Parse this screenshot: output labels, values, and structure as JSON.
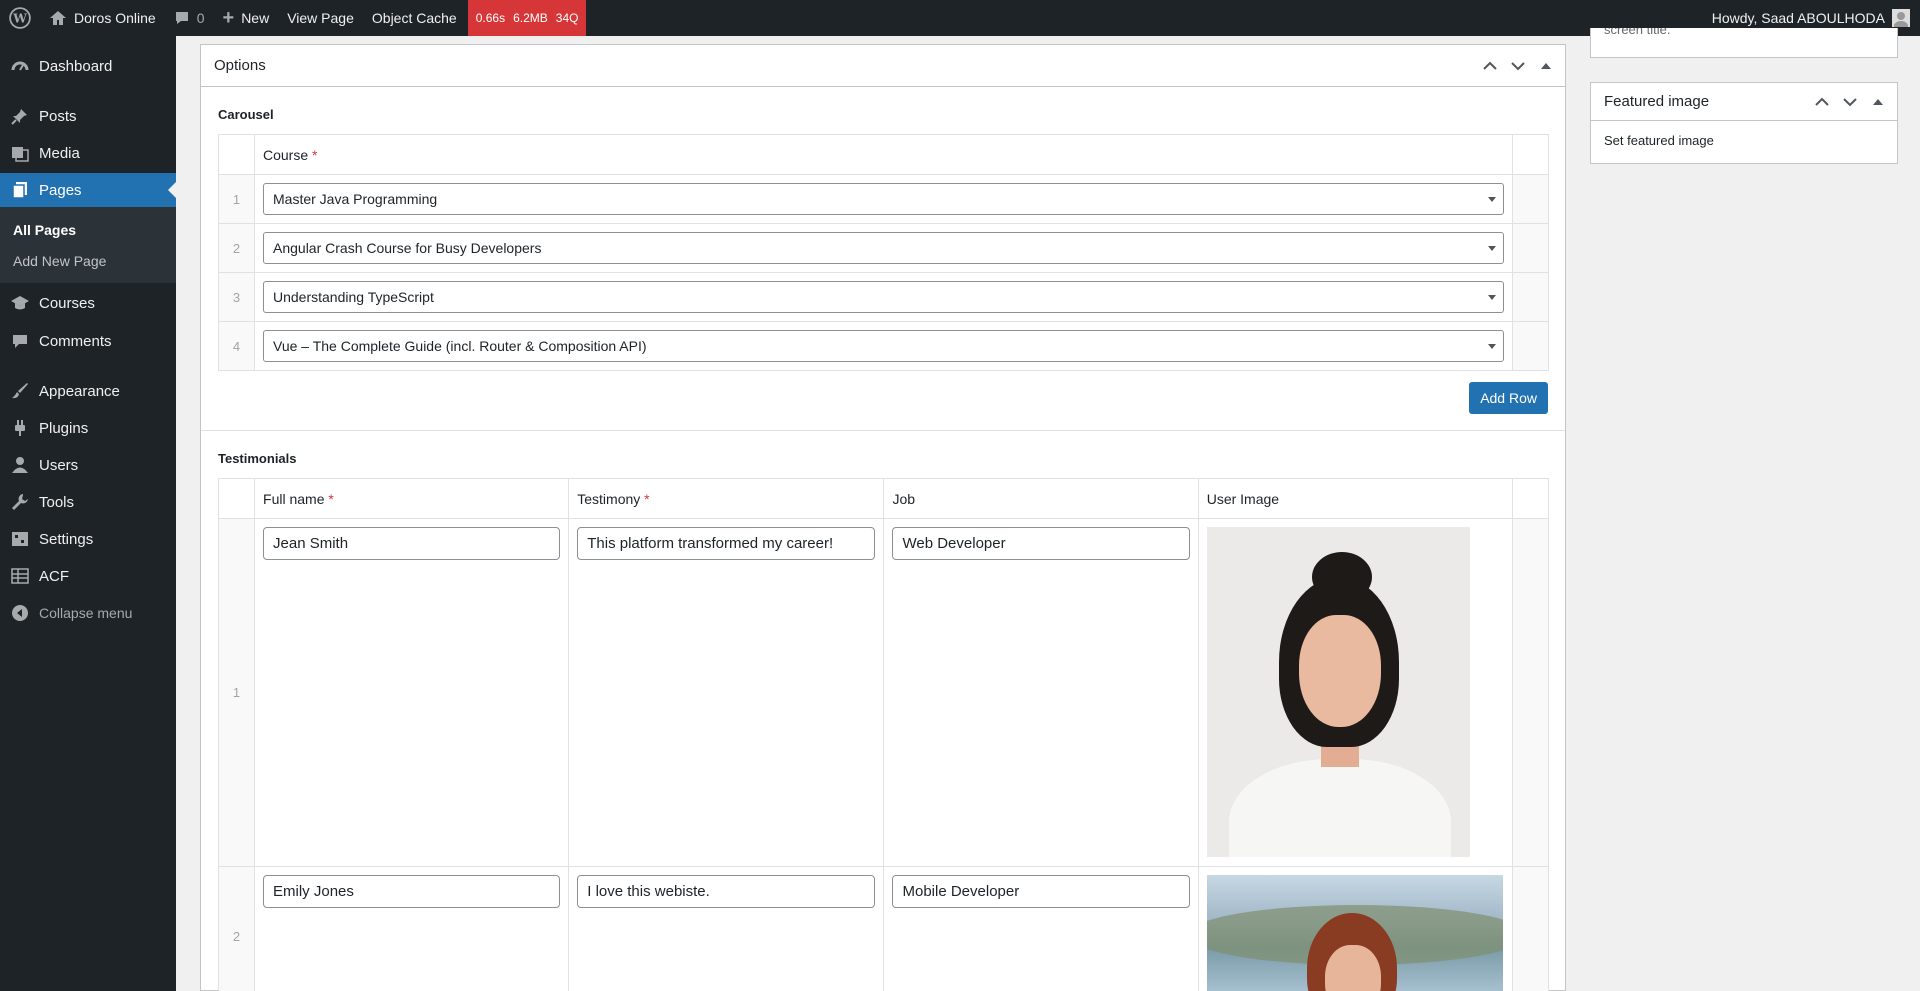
{
  "admin_bar": {
    "site_name": "Doros Online",
    "comments_count": "0",
    "new_label": "New",
    "view_page_label": "View Page",
    "object_cache_label": "Object Cache",
    "perf_time": "0.66s",
    "perf_memory": "6.2MB",
    "perf_queries": "34Q",
    "greeting": "Howdy, Saad ABOULHODA"
  },
  "sidebar": {
    "items": [
      {
        "label": "Dashboard",
        "icon": "dashboard-icon"
      },
      {
        "label": "Posts",
        "icon": "pin-icon"
      },
      {
        "label": "Media",
        "icon": "media-icon"
      },
      {
        "label": "Pages",
        "icon": "pages-icon"
      },
      {
        "label": "Courses",
        "icon": "graduation-cap-icon"
      },
      {
        "label": "Comments",
        "icon": "comment-icon"
      },
      {
        "label": "Appearance",
        "icon": "brush-icon"
      },
      {
        "label": "Plugins",
        "icon": "plug-icon"
      },
      {
        "label": "Users",
        "icon": "user-icon"
      },
      {
        "label": "Tools",
        "icon": "wrench-icon"
      },
      {
        "label": "Settings",
        "icon": "settings-icon"
      },
      {
        "label": "ACF",
        "icon": "grid-icon"
      }
    ],
    "pages_submenu": [
      "All Pages",
      "Add New Page"
    ],
    "collapse_label": "Collapse menu"
  },
  "options_box": {
    "title": "Options",
    "carousel": {
      "label": "Carousel",
      "column_course": "Course",
      "rows": [
        {
          "num": "1",
          "course": "Master Java Programming"
        },
        {
          "num": "2",
          "course": "Angular Crash Course for Busy Developers"
        },
        {
          "num": "3",
          "course": "Understanding TypeScript"
        },
        {
          "num": "4",
          "course": "Vue – The Complete Guide (incl. Router & Composition API)"
        }
      ],
      "add_row_label": "Add Row"
    },
    "testimonials": {
      "label": "Testimonials",
      "columns": {
        "full_name": "Full name",
        "testimony": "Testimony",
        "job": "Job",
        "user_image": "User Image"
      },
      "rows": [
        {
          "num": "1",
          "full_name": "Jean Smith",
          "testimony": "This platform transformed my career!",
          "job": "Web Developer"
        },
        {
          "num": "2",
          "full_name": "Emily Jones",
          "testimony": "I love this webiste.",
          "job": "Mobile Developer"
        }
      ]
    },
    "required_marker": "*"
  },
  "right_panel": {
    "clipped_text": "screen title.",
    "featured_image_title": "Featured image",
    "set_featured_image_link": "Set featured image"
  },
  "colors": {
    "admin_dark": "#1d2327",
    "accent_blue": "#2271b1",
    "perf_red": "#d63638",
    "required_red": "#d63638"
  }
}
